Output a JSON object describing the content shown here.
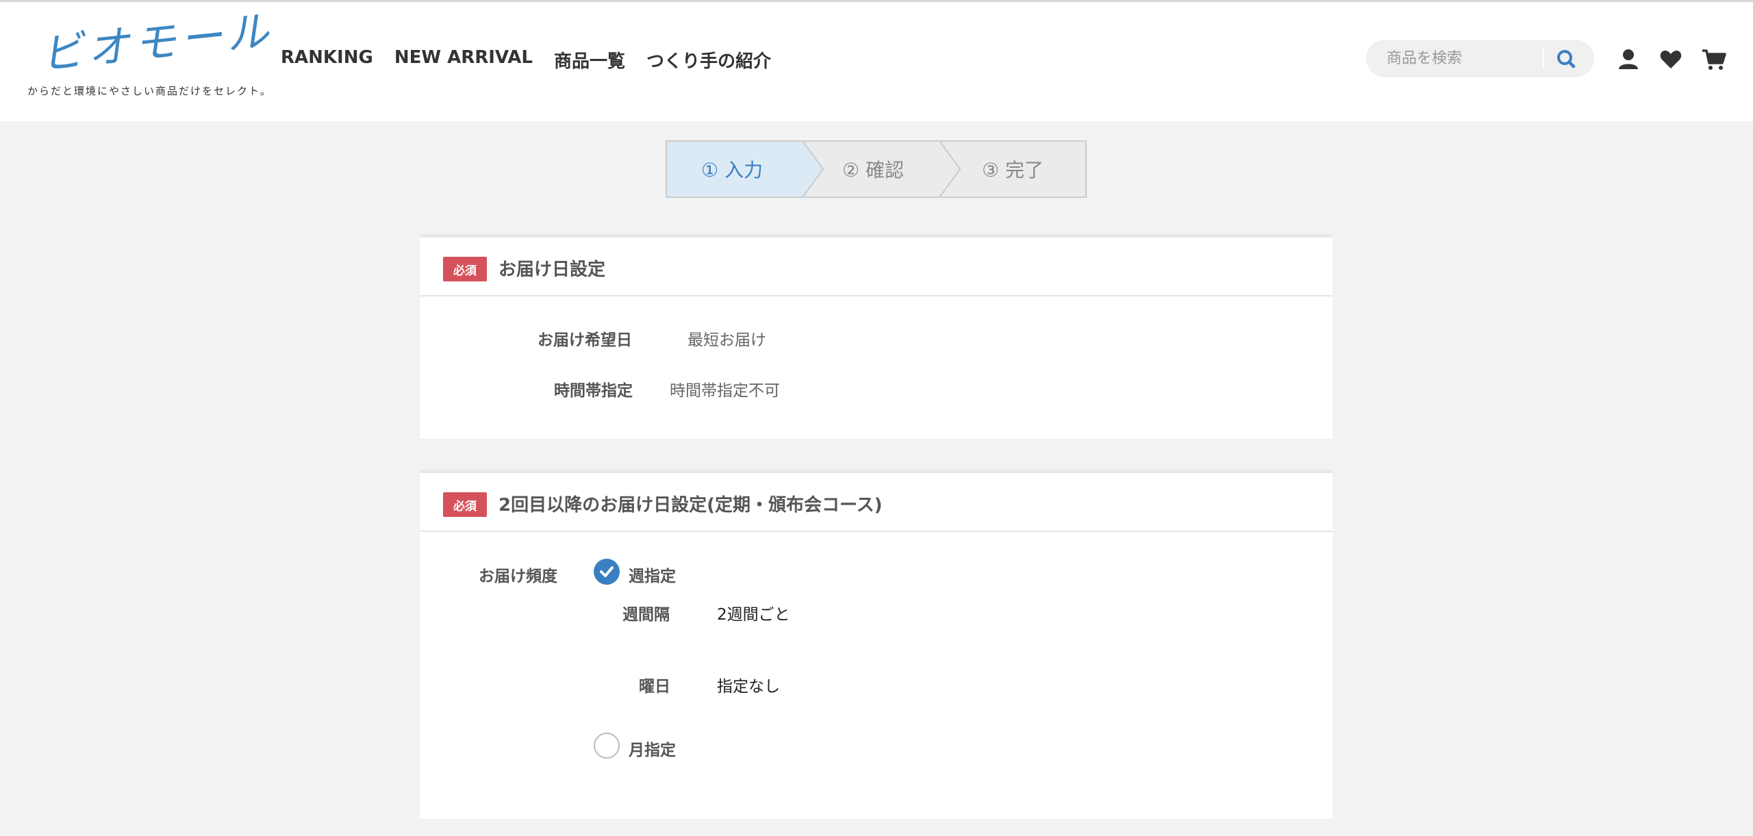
{
  "header": {
    "logo_text": "ビオモール",
    "logo_tagline": "からだと環境にやさしい商品だけをセレクト。",
    "nav": [
      "RANKING",
      "NEW ARRIVAL",
      "商品一覧",
      "つくり手の紹介"
    ],
    "search_placeholder": "商品を検索",
    "icons": [
      "search-icon",
      "user-icon",
      "heart-icon",
      "cart-icon"
    ],
    "accent_color": "#3c87c4"
  },
  "steps": [
    {
      "label": "① 入力",
      "active": true
    },
    {
      "label": "② 確認",
      "active": false
    },
    {
      "label": "③ 完了",
      "active": false
    }
  ],
  "delivery_section": {
    "badge": "必須",
    "title": "お届け日設定",
    "rows": [
      {
        "label": "お届け希望日",
        "value": "最短お届け"
      },
      {
        "label": "時間帯指定",
        "value": "時間帯指定不可"
      }
    ]
  },
  "subscription_section": {
    "badge": "必須",
    "title": "2回目以降のお届け日設定(定期・頒布会コース)",
    "frequency_label": "お届け頻度",
    "options": [
      {
        "label": "週指定",
        "checked": true
      },
      {
        "label": "月指定",
        "checked": false
      }
    ],
    "week": {
      "interval_label": "週間隔",
      "interval_value": "2週間ごと",
      "day_label": "曜日",
      "day_value": "指定なし"
    }
  },
  "colors": {
    "badge_red": "#d6525b",
    "step_active_bg": "#dceaf6",
    "step_active_text": "#3a7fc1",
    "radio_checked": "#3a7fc1"
  }
}
